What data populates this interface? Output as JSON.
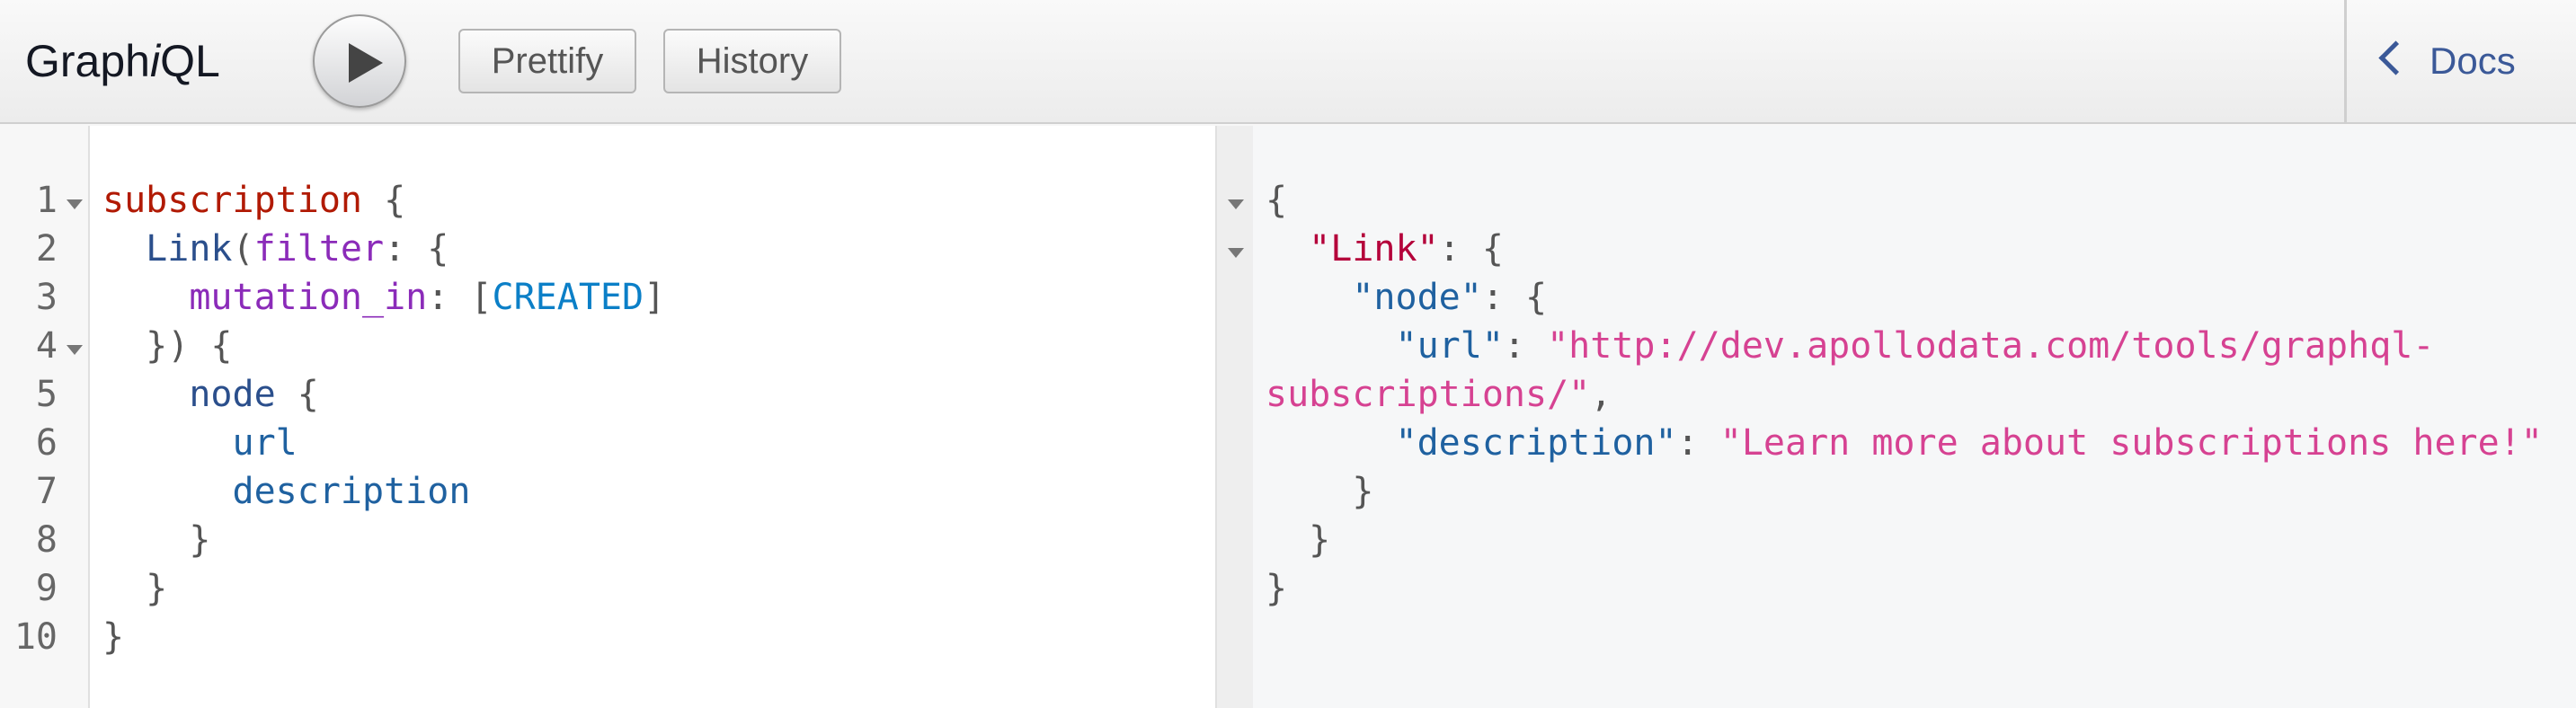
{
  "toolbar": {
    "title_pre": "Graph",
    "title_i": "i",
    "title_post": "QL",
    "prettify": "Prettify",
    "history": "History",
    "docs": "Docs"
  },
  "editor": {
    "line_numbers": [
      "1",
      "2",
      "3",
      "4",
      "5",
      "6",
      "7",
      "8",
      "9",
      "10"
    ],
    "lines": [
      [
        {
          "t": "subscription",
          "c": "kw"
        },
        {
          "t": " {",
          "c": "punct"
        }
      ],
      [
        {
          "t": "  ",
          "c": "punct"
        },
        {
          "t": "Link",
          "c": "def"
        },
        {
          "t": "(",
          "c": "punct"
        },
        {
          "t": "filter",
          "c": "attr"
        },
        {
          "t": ": {",
          "c": "punct"
        }
      ],
      [
        {
          "t": "    ",
          "c": "punct"
        },
        {
          "t": "mutation_in",
          "c": "attr"
        },
        {
          "t": ": [",
          "c": "punct"
        },
        {
          "t": "CREATED",
          "c": "enum"
        },
        {
          "t": "]",
          "c": "punct"
        }
      ],
      [
        {
          "t": "  }) {",
          "c": "punct"
        }
      ],
      [
        {
          "t": "    ",
          "c": "punct"
        },
        {
          "t": "node",
          "c": "def"
        },
        {
          "t": " {",
          "c": "punct"
        }
      ],
      [
        {
          "t": "      ",
          "c": "punct"
        },
        {
          "t": "url",
          "c": "prop"
        }
      ],
      [
        {
          "t": "      ",
          "c": "punct"
        },
        {
          "t": "description",
          "c": "prop"
        }
      ],
      [
        {
          "t": "    }",
          "c": "punct"
        }
      ],
      [
        {
          "t": "  }",
          "c": "punct"
        }
      ],
      [
        {
          "t": "}",
          "c": "punct"
        }
      ]
    ]
  },
  "result": {
    "lines": [
      [
        {
          "t": "{",
          "c": "punct"
        }
      ],
      [
        {
          "t": "  ",
          "c": "punct"
        },
        {
          "t": "\"Link\"",
          "c": "jlink"
        },
        {
          "t": ": {",
          "c": "punct"
        }
      ],
      [
        {
          "t": "    ",
          "c": "punct"
        },
        {
          "t": "\"node\"",
          "c": "jkey"
        },
        {
          "t": ": {",
          "c": "punct"
        }
      ],
      [
        {
          "t": "      ",
          "c": "punct"
        },
        {
          "t": "\"url\"",
          "c": "jkey"
        },
        {
          "t": ": ",
          "c": "punct"
        },
        {
          "t": "\"http://dev.apollodata.com/tools/graphql-",
          "c": "jstr"
        }
      ],
      [
        {
          "t": "subscriptions/\"",
          "c": "jstr"
        },
        {
          "t": ",",
          "c": "punct"
        }
      ],
      [
        {
          "t": "      ",
          "c": "punct"
        },
        {
          "t": "\"description\"",
          "c": "jkey"
        },
        {
          "t": ": ",
          "c": "punct"
        },
        {
          "t": "\"Learn more about subscriptions here!\"",
          "c": "jstr"
        }
      ],
      [
        {
          "t": "    }",
          "c": "punct"
        }
      ],
      [
        {
          "t": "  }",
          "c": "punct"
        }
      ],
      [
        {
          "t": "}",
          "c": "punct"
        }
      ]
    ]
  }
}
